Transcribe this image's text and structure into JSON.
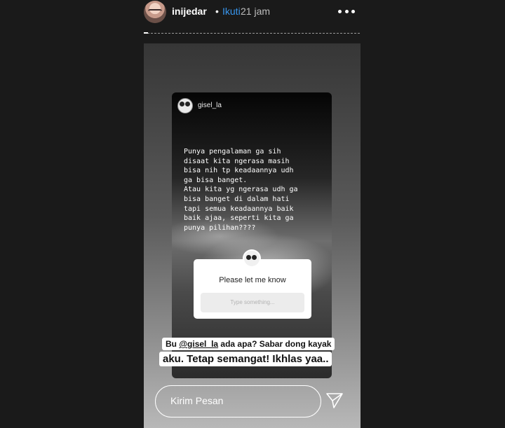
{
  "header": {
    "username": "inijedar",
    "separator": "•",
    "follow_label": "Ikuti",
    "time_ago": "21 jam",
    "progress_value": 0.02
  },
  "shared_post": {
    "username": "gisel_la",
    "text": "Punya pengalaman ga sih\ndisaat kita ngerasa masih\nbisa nih tp keadaannya udh\nga bisa banget.\nAtau kita yg ngerasa udh ga\nbisa banget di dalam hati\ntapi semua keadaannya baik\nbaik ajaa, seperti kita ga\npunya pilihan????",
    "question": {
      "title": "Please let me know",
      "placeholder": "Type something..."
    }
  },
  "caption": {
    "line1_prefix": "Bu ",
    "line1_mention": "@gisel_la",
    "line1_suffix": " ada apa? Sabar dong kayak",
    "line2": "aku. Tetap semangat! Ikhlas yaa.."
  },
  "reply": {
    "placeholder": "Kirim Pesan"
  },
  "icons": {
    "more": "more-icon",
    "send": "send-icon"
  }
}
